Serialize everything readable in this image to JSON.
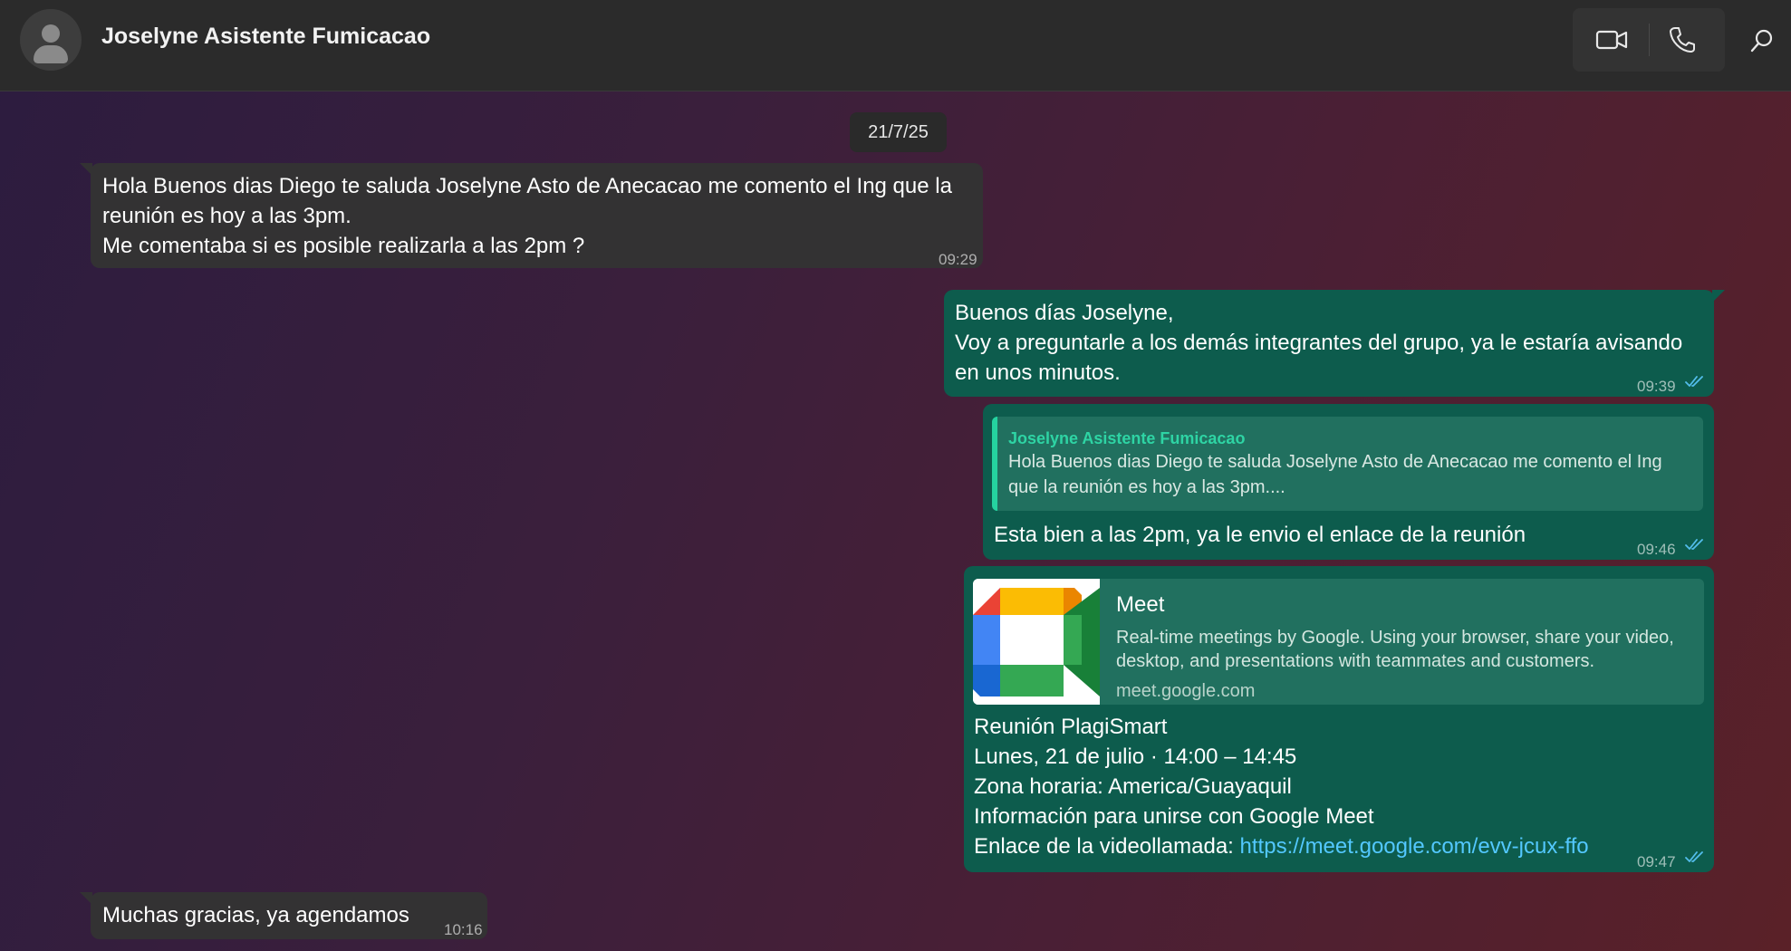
{
  "header": {
    "contact_name": "Joselyne Asistente Fumicacao",
    "icons": {
      "avatar": "default-avatar",
      "video": "video-camera-icon",
      "phone": "phone-icon",
      "search": "search-icon"
    }
  },
  "date_separator": "21/7/25",
  "messages": [
    {
      "direction": "incoming",
      "text": "Hola Buenos dias Diego te saluda Joselyne Asto de Anecacao me comento el Ing que la\nreunión es hoy a las 3pm.\nMe comentaba si es posible realizarla a las 2pm ?",
      "time": "09:29"
    },
    {
      "direction": "outgoing",
      "text": "Buenos días Joselyne,\nVoy a preguntarle a los demás integrantes del grupo, ya le estaría avisando\nen unos minutos.",
      "time": "09:39",
      "status": "read"
    },
    {
      "direction": "outgoing",
      "quote": {
        "name": "Joselyne Asistente Fumicacao",
        "text": "Hola Buenos dias Diego te saluda Joselyne Asto de Anecacao me comento el Ing que la reunión es hoy a las 3pm...."
      },
      "text": "Esta bien a las 2pm, ya le envio el enlace de la reunión",
      "time": "09:46",
      "status": "read"
    },
    {
      "direction": "outgoing",
      "preview": {
        "title": "Meet",
        "description": "Real-time meetings by Google. Using your browser, share your video, desktop, and presentations with teammates and customers.",
        "domain": "meet.google.com",
        "icon": "google-meet-logo"
      },
      "lines": [
        "Reunión PlagiSmart",
        "Lunes, 21 de julio · 14:00 – 14:45",
        "Zona horaria: America/Guayaquil",
        "Información para unirse con Google Meet"
      ],
      "link_prefix": "Enlace de la videollamada: ",
      "link": "https://meet.google.com/evv-jcux-ffo",
      "time": "09:47",
      "status": "read"
    },
    {
      "direction": "incoming",
      "text": "Muchas gracias, ya agendamos",
      "time": "10:16"
    }
  ],
  "colors": {
    "incoming_bubble": "#333233",
    "outgoing_bubble": "#0d5c4d",
    "quote_accent": "#25d3a0",
    "link": "#53c8ff",
    "read_ticks": "#53bdeb"
  }
}
